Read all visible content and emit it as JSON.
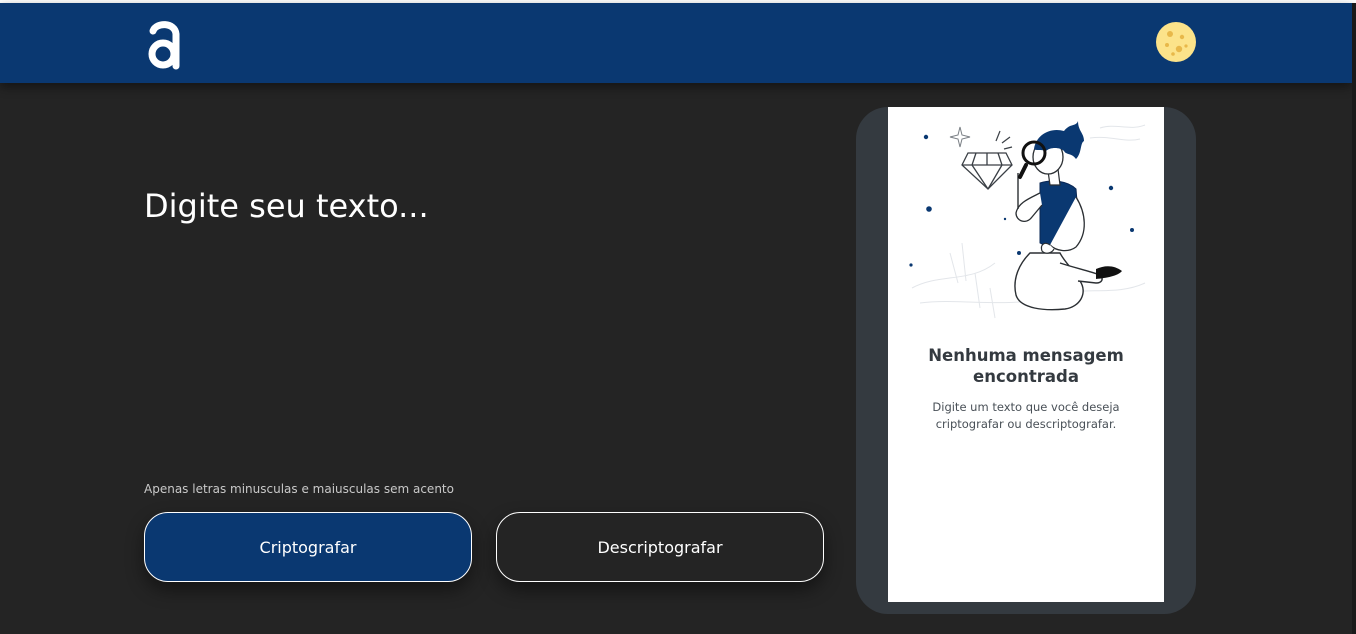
{
  "header": {
    "logo_icon": "alura-a-logo-icon",
    "theme_toggle_icon": "moon-icon"
  },
  "main": {
    "input_placeholder": "Digite seu texto...",
    "hint": "Apenas letras minusculas e maiusculas sem acento",
    "encrypt_label": "Criptografar",
    "decrypt_label": "Descriptografar"
  },
  "result": {
    "illustration": "person-with-magnifying-glass-illustration",
    "title": "Nenhuma mensagem encontrada",
    "text": "Digite um texto que você deseja criptografar ou descriptografar."
  },
  "colors": {
    "header_bg": "#0a3871",
    "page_bg": "#242424",
    "primary_button": "#0a3871",
    "result_frame": "#343a40",
    "card_bg": "#ffffff",
    "moon": "#fce38a"
  }
}
